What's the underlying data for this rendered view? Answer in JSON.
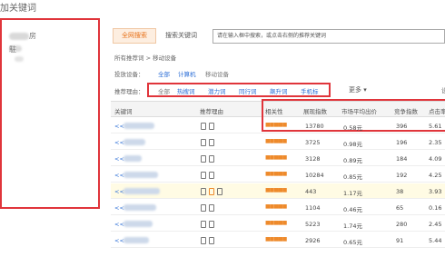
{
  "page_title": "加关键词",
  "tabs": {
    "active": "全网搜索",
    "second": "搜索关键词"
  },
  "search": {
    "placeholder": "请在输入框中搜索，或点击右侧的推荐关键词"
  },
  "breadcrumb": {
    "root": "所有推荐词",
    "sep": ">",
    "current": "移动设备"
  },
  "device_row": {
    "label": "投放设备：",
    "options": [
      "全部",
      "计算机",
      "移动设备"
    ]
  },
  "category_row": {
    "label": "推荐理由：",
    "options": [
      "全部",
      "热搜词",
      "潜力词",
      "同行词",
      "飙升词",
      "手机标"
    ]
  },
  "more": "更多 ▾",
  "settings": "设",
  "columns": [
    "关键词",
    "推荐理由",
    "相关性",
    "展现指数",
    "市场平均出价",
    "竞争指数",
    "点击率"
  ],
  "rows": [
    {
      "kw": "<<",
      "vol": "13780",
      "price": "0.58元",
      "comp": "396",
      "ctr": "5.61"
    },
    {
      "kw": "<<",
      "vol": "3725",
      "price": "0.98元",
      "comp": "196",
      "ctr": "2.35"
    },
    {
      "kw": "<<",
      "vol": "3128",
      "price": "0.89元",
      "comp": "184",
      "ctr": "4.09"
    },
    {
      "kw": "<<",
      "vol": "10284",
      "price": "0.85元",
      "comp": "192",
      "ctr": "4.25"
    },
    {
      "kw": "<<",
      "vol": "443",
      "price": "1.17元",
      "comp": "38",
      "ctr": "3.93"
    },
    {
      "kw": "<<",
      "vol": "1104",
      "price": "0.46元",
      "comp": "65",
      "ctr": "0.16"
    },
    {
      "kw": "<<",
      "vol": "5223",
      "price": "1.74元",
      "comp": "280",
      "ctr": "2.45"
    },
    {
      "kw": "<<",
      "vol": "2926",
      "price": "0.65元",
      "comp": "91",
      "ctr": "5.44"
    }
  ],
  "stars": "■■■■■",
  "left_panel": {
    "item1": "房",
    "item2": "駐"
  },
  "colors": {
    "highlight_border": "#e0353b",
    "link": "#2a6dd6",
    "accent": "#e8731b"
  }
}
